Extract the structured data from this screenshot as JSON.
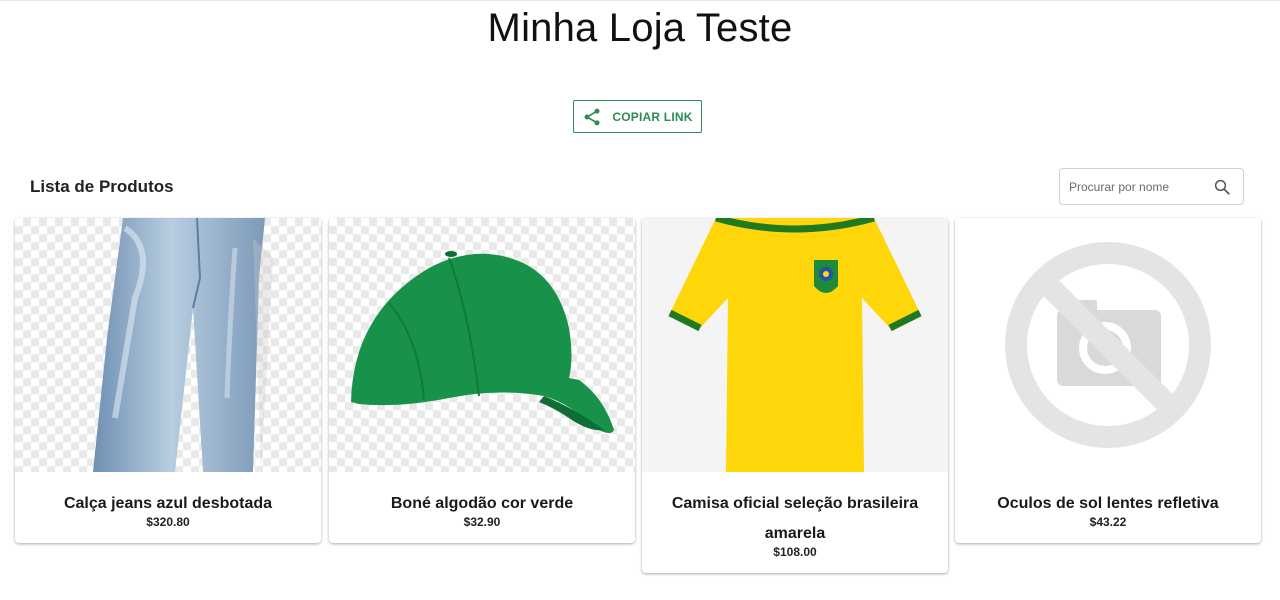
{
  "store": {
    "title": "Minha Loja Teste"
  },
  "share": {
    "copy_label": "COPIAR LINK"
  },
  "products_section": {
    "title": "Lista de Produtos",
    "search": {
      "placeholder": "Procurar por nome",
      "value": ""
    }
  },
  "products": [
    {
      "name": "Calça jeans azul desbotada",
      "price": "$320.80",
      "image": "jeans"
    },
    {
      "name": "Boné algodão cor verde",
      "price": "$32.90",
      "image": "green-cap"
    },
    {
      "name": "Camisa oficial seleção brasileira amarela",
      "price": "$108.00",
      "image": "brazil-shirt"
    },
    {
      "name": "Oculos de sol lentes refletiva",
      "price": "$43.22",
      "image": "no-image"
    }
  ],
  "colors": {
    "accent": "#2e8b57",
    "shirt_yellow": "#ffd60a",
    "shirt_green": "#1f7a1f",
    "cap_green": "#18924a"
  }
}
